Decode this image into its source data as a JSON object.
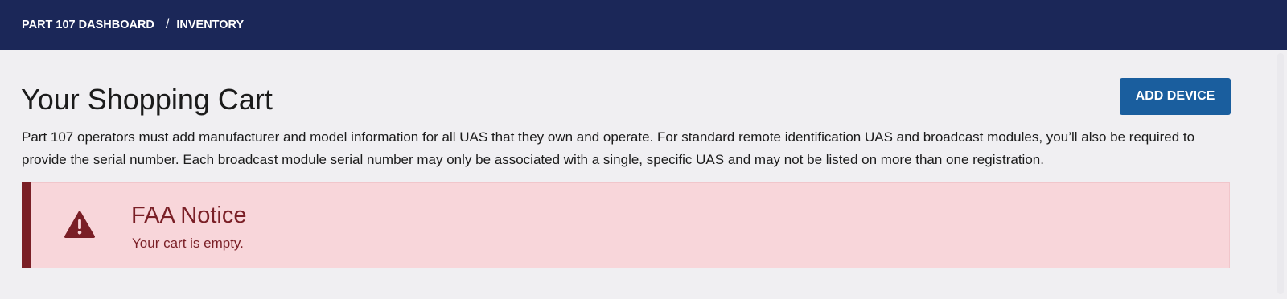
{
  "breadcrumb": {
    "items": [
      "PART 107 DASHBOARD",
      "INVENTORY"
    ],
    "separator": "/"
  },
  "page": {
    "title": "Your Shopping Cart",
    "add_button_label": "ADD DEVICE",
    "intro": "Part 107 operators must add manufacturer and model information for all UAS that they own and operate. For standard remote identification UAS and broadcast modules, you’ll also be required to provide the serial number. Each broadcast module serial number may only be associated with a single, specific UAS and may not be listed on more than one registration."
  },
  "notice": {
    "icon": "warning-icon",
    "heading": "FAA Notice",
    "text": "Your cart is empty."
  },
  "colors": {
    "header_bg": "#1b2758",
    "button_bg": "#1a5e9e",
    "alert_bg": "#f8d6da",
    "alert_accent": "#7a1f26",
    "page_bg": "#f0eff2"
  }
}
